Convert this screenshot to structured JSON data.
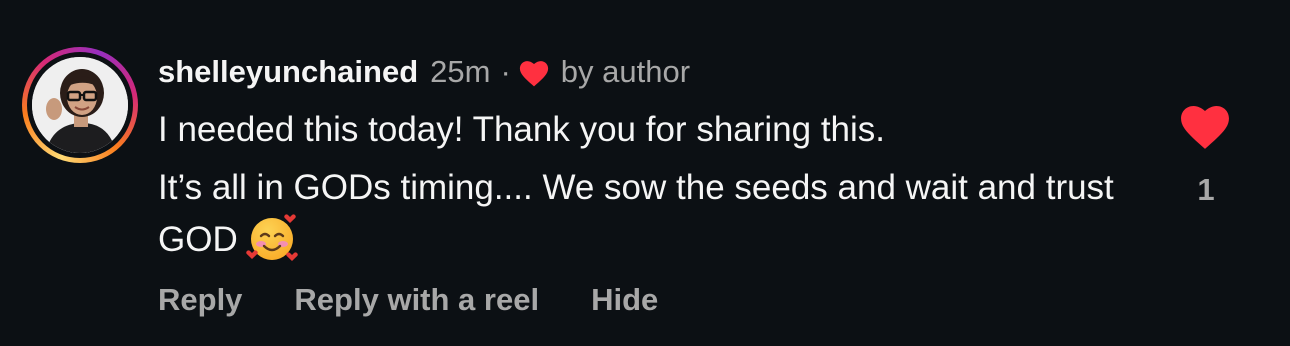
{
  "comment": {
    "username": "shelleyunchained",
    "time": "25m",
    "separator": "·",
    "liked_by_author_label": "by author",
    "paragraph1": "I needed this today! Thank you for sharing this.",
    "paragraph2": "It’s all in GODs timing.... We sow the seeds and wait and trust GOD",
    "emoji": "smiling-face-with-hearts-icon",
    "like_count": "1",
    "liked": true
  },
  "actions": {
    "reply": "Reply",
    "reply_with_reel": "Reply with a reel",
    "hide": "Hide"
  },
  "colors": {
    "background": "#0c1014",
    "primary_text": "#f5f5f5",
    "secondary_text": "#a8a8a8",
    "heart_red": "#ff3040"
  }
}
